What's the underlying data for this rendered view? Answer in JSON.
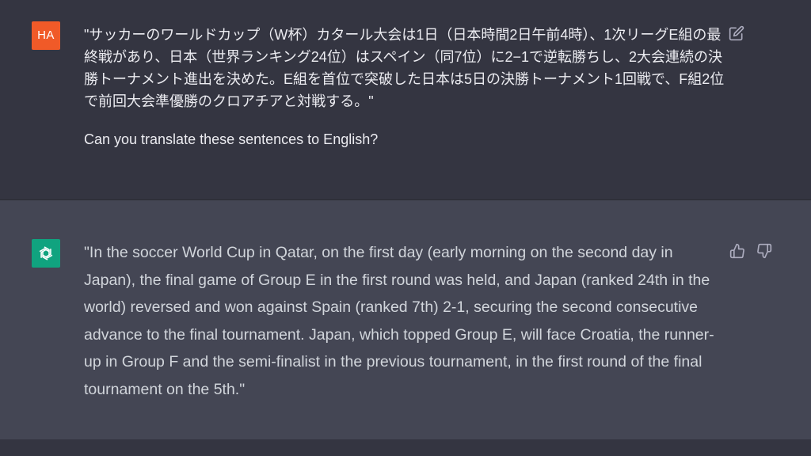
{
  "user_message": {
    "avatar_initials": "HA",
    "quote": "\"サッカーのワールドカップ（W杯）カタール大会は1日（日本時間2日午前4時）、1次リーグE組の最終戦があり、日本（世界ランキング24位）はスペイン（同7位）に2−1で逆転勝ちし、2大会連続の決勝トーナメント進出を決めた。E組を首位で突破した日本は5日の決勝トーナメント1回戦で、F組2位で前回大会準優勝のクロアチアと対戦する。\"",
    "question": "Can you translate these sentences to English?",
    "edit_icon": "edit-icon"
  },
  "assistant_message": {
    "avatar_icon": "openai-logo-icon",
    "text": "\"In the soccer World Cup in Qatar, on the first day (early morning on the second day in Japan), the final game of Group E in the first round was held, and Japan (ranked 24th in the world) reversed and won against Spain (ranked 7th) 2-1, securing the second consecutive advance to the final tournament. Japan, which topped Group E, will face Croatia, the runner-up in Group F and the semi-finalist in the previous tournament, in the first round of the final tournament on the 5th.\"",
    "thumbs_up_icon": "thumbs-up-icon",
    "thumbs_down_icon": "thumbs-down-icon"
  },
  "colors": {
    "user_bg": "#343541",
    "assistant_bg": "#444654",
    "user_avatar": "#f05a28",
    "bot_avatar": "#10a37f"
  }
}
